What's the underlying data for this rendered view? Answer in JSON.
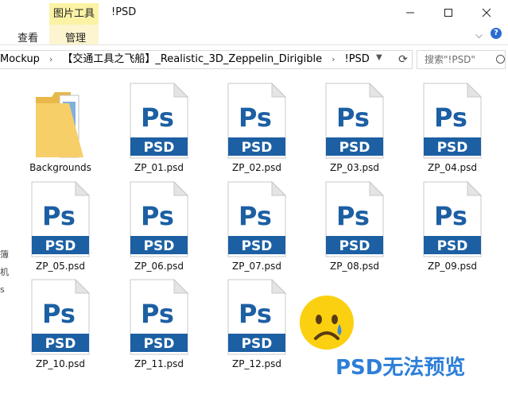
{
  "ribbon": {
    "context_tab_group": "图片工具",
    "tab_view": "查看",
    "tab_manage": "管理",
    "window_title": "!PSD"
  },
  "address": {
    "segments": [
      "Mockup",
      "【交通工具之飞船】_Realistic_3D_Zeppelin_Dirigible",
      "!PSD"
    ],
    "search_placeholder": "搜索\"!PSD\""
  },
  "left_pane": [
    "簿",
    "机",
    "s"
  ],
  "files": [
    {
      "name": "Backgrounds",
      "type": "folder"
    },
    {
      "name": "ZP_01.psd",
      "type": "psd"
    },
    {
      "name": "ZP_02.psd",
      "type": "psd"
    },
    {
      "name": "ZP_03.psd",
      "type": "psd"
    },
    {
      "name": "ZP_04.psd",
      "type": "psd"
    },
    {
      "name": "ZP_05.psd",
      "type": "psd"
    },
    {
      "name": "ZP_06.psd",
      "type": "psd"
    },
    {
      "name": "ZP_07.psd",
      "type": "psd"
    },
    {
      "name": "ZP_08.psd",
      "type": "psd"
    },
    {
      "name": "ZP_09.psd",
      "type": "psd"
    },
    {
      "name": "ZP_10.psd",
      "type": "psd"
    },
    {
      "name": "ZP_11.psd",
      "type": "psd"
    },
    {
      "name": "ZP_12.psd",
      "type": "psd"
    }
  ],
  "psd_icon": {
    "glyph": "Ps",
    "badge": "PSD",
    "color": "#1c5fa3"
  },
  "overlay": {
    "emoji": "crying-face",
    "watermark": "PSD无法预览"
  }
}
